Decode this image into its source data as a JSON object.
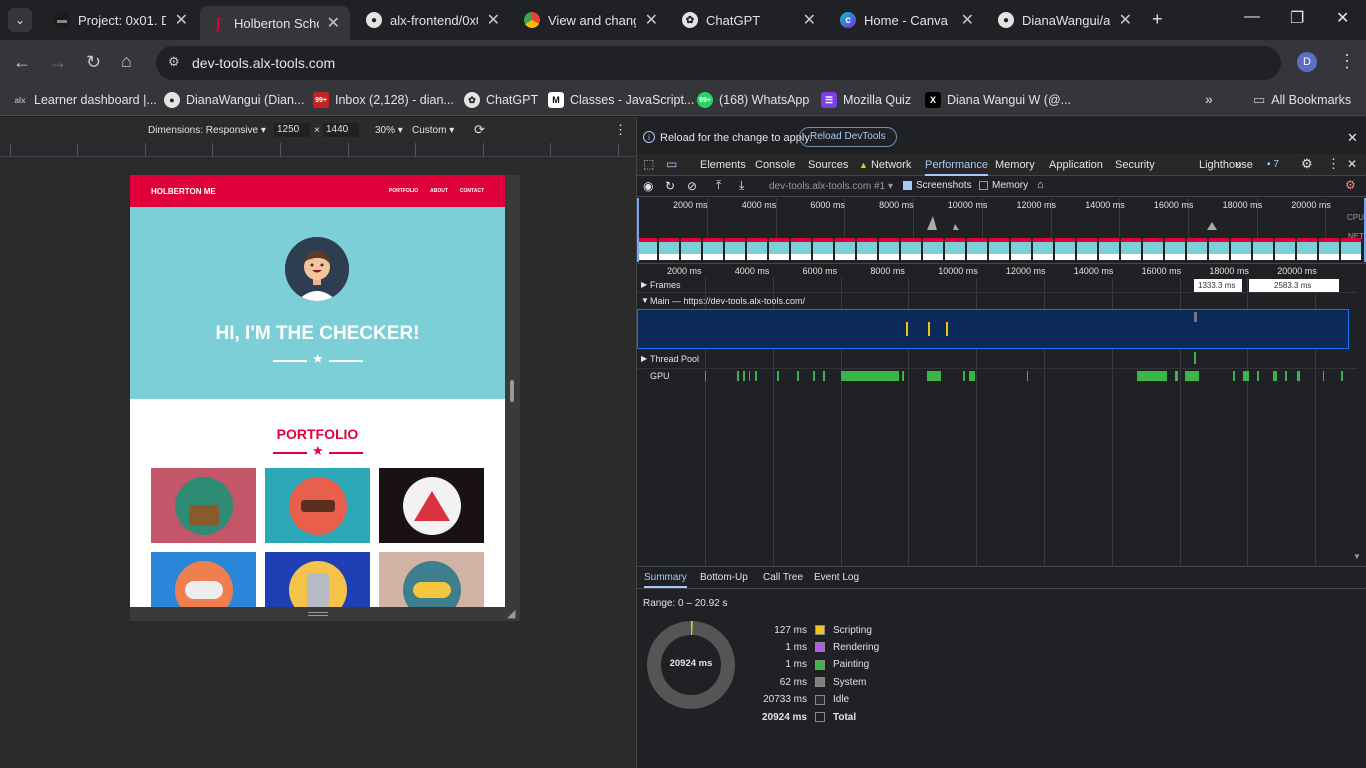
{
  "tabs": [
    {
      "title": "Project: 0x01. De",
      "icon": "alx-icon"
    },
    {
      "title": "Holberton Schoo",
      "icon": "holberton-icon",
      "active": true
    },
    {
      "title": "alx-frontend/0x0",
      "icon": "github-icon"
    },
    {
      "title": "View and change",
      "icon": "chrome-icon"
    },
    {
      "title": "ChatGPT",
      "icon": "chatgpt-icon"
    },
    {
      "title": "Home - Canva",
      "icon": "canva-icon"
    },
    {
      "title": "DianaWangui/alx",
      "icon": "github-icon"
    }
  ],
  "omnibox": {
    "url": "dev-tools.alx-tools.com"
  },
  "profile": {
    "initial": "D"
  },
  "bookmarks": [
    {
      "label": "Learner dashboard |...",
      "icon": "alx-icon"
    },
    {
      "label": "DianaWangui (Dian...",
      "icon": "github-icon"
    },
    {
      "label": "Inbox (2,128) - dian...",
      "icon": "gmail-icon"
    },
    {
      "label": "ChatGPT",
      "icon": "chatgpt-icon"
    },
    {
      "label": "Classes - JavaScript...",
      "icon": "m-icon"
    },
    {
      "label": "(168) WhatsApp",
      "icon": "whatsapp-icon"
    },
    {
      "label": "Mozilla Quiz",
      "icon": "quiz-icon"
    },
    {
      "label": "Diana Wangui W (@...",
      "icon": "x-icon"
    }
  ],
  "all_bookmarks": "All Bookmarks",
  "device_bar": {
    "dimensions_label": "Dimensions: Responsive ▾",
    "width": "1250",
    "times": "×",
    "height": "1440",
    "zoom": "30% ▾",
    "throttle": "Custom ▾"
  },
  "site": {
    "brand": "HOLBERTON ME",
    "nav": [
      "PORTFOLIO",
      "ABOUT",
      "CONTACT"
    ],
    "hero_title": "HI, I'M THE CHECKER!",
    "portfolio_title": "PORTFOLIO",
    "colors": {
      "primary": "#e0003c",
      "hero": "#7ccfd6"
    }
  },
  "devtools": {
    "info_message": "Reload for the change to apply.",
    "reload_button": "Reload DevTools",
    "tabs": [
      "Elements",
      "Console",
      "Sources",
      "Network",
      "Performance",
      "Memory",
      "Application",
      "Security",
      "Lighthouse"
    ],
    "active_tab": "Performance",
    "issues_count": "7",
    "recording_select": "dev-tools.alx-tools.com #1 ▾",
    "screenshots_label": "Screenshots",
    "memory_label": "Memory",
    "overview_ticks": [
      "2000 ms",
      "4000 ms",
      "6000 ms",
      "8000 ms",
      "10000 ms",
      "12000 ms",
      "14000 ms",
      "16000 ms",
      "18000 ms",
      "20000 ms"
    ],
    "cpu_label": "CPU",
    "net_label": "NET",
    "timeline_ticks": [
      "2000 ms",
      "4000 ms",
      "6000 ms",
      "8000 ms",
      "10000 ms",
      "12000 ms",
      "14000 ms",
      "16000 ms",
      "18000 ms",
      "20000 ms",
      "2"
    ],
    "frames_label": "Frames",
    "frame_badges": [
      "1333.3 ms",
      "2583.3 ms"
    ],
    "main_label": "Main — https://dev-tools.alx-tools.com/",
    "thread_pool_label": "Thread Pool",
    "gpu_label": "GPU",
    "bottom_tabs": [
      "Summary",
      "Bottom-Up",
      "Call Tree",
      "Event Log"
    ],
    "range": "Range: 0 – 20.92 s",
    "donut_total": "20924 ms",
    "summary": [
      {
        "value": "127 ms",
        "label": "Scripting",
        "color": "#f2c31b"
      },
      {
        "value": "1 ms",
        "label": "Rendering",
        "color": "#af5fe6"
      },
      {
        "value": "1 ms",
        "label": "Painting",
        "color": "#39b54a"
      },
      {
        "value": "62 ms",
        "label": "System",
        "color": "#808080"
      },
      {
        "value": "20733 ms",
        "label": "Idle",
        "color": "#2b2b2b"
      },
      {
        "value": "20924 ms",
        "label": "Total",
        "color": "#202124"
      }
    ]
  }
}
